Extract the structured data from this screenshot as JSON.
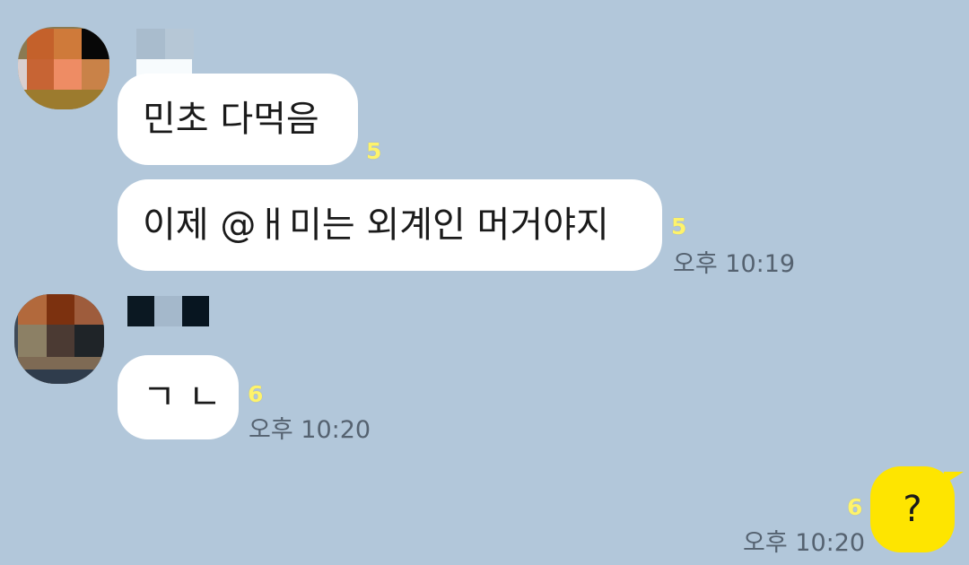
{
  "colors": {
    "chat_background": "#b2c7da",
    "incoming_bubble": "#ffffff",
    "outgoing_bubble": "#fee500",
    "unread_count": "#fef36b",
    "timestamp": "#556270"
  },
  "messages": [
    {
      "text": "민초 다먹음",
      "unread": "5"
    },
    {
      "text": "이제 @ㅐ미는 외계인 머거야지",
      "unread": "5",
      "time": "오후 10:19"
    },
    {
      "text": "ㄱㄴ",
      "unread": "6",
      "time": "오후 10:20"
    },
    {
      "text": "?",
      "unread": "6",
      "time": "오후 10:20"
    }
  ]
}
